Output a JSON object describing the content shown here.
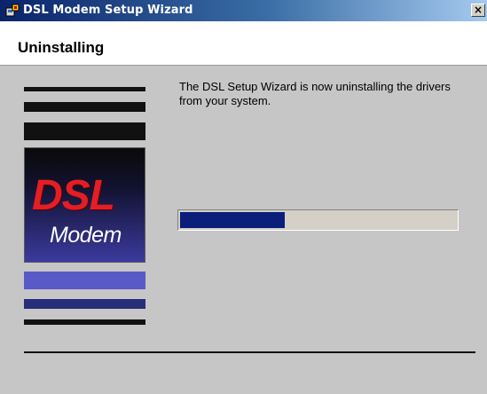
{
  "window": {
    "title": "DSL Modem Setup Wizard",
    "icon": "setup-wizard-icon",
    "close_glyph": "×"
  },
  "header": {
    "title": "Uninstalling"
  },
  "logo": {
    "line1": "DSL",
    "line2": "Modem"
  },
  "main": {
    "description": "The DSL Setup Wizard is now uninstalling the drivers from your system.",
    "progress_fraction": 0.38
  },
  "colors": {
    "titlebar_start": "#0a246a",
    "progress_fill": "#0a1e7a",
    "logo_red": "#e31e24",
    "panel_bg": "#c6c6c6"
  }
}
